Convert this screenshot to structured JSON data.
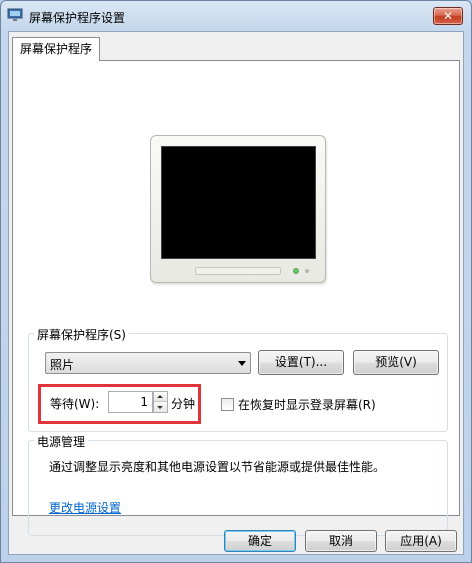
{
  "window": {
    "title": "屏幕保护程序设置"
  },
  "tab": {
    "label": "屏幕保护程序"
  },
  "screensaver": {
    "group_label": "屏幕保护程序(S)",
    "selected": "照片",
    "settings_label": "设置(T)...",
    "preview_label": "预览(V)",
    "wait_label": "等待(W):",
    "wait_value": "1",
    "minutes_label": "分钟",
    "resume_checkbox_label": "在恢复时显示登录屏幕(R)",
    "resume_checked": false
  },
  "power": {
    "group_label": "电源管理",
    "description": "通过调整显示亮度和其他电源设置以节省能源或提供最佳性能。",
    "link": "更改电源设置"
  },
  "buttons": {
    "ok": "确定",
    "cancel": "取消",
    "apply": "应用(A)"
  },
  "icons": {
    "window_icon": "monitor-settings-icon",
    "close": "close-icon",
    "dropdown": "chevron-down-icon",
    "spin_up": "arrow-up-icon",
    "spin_down": "arrow-down-icon"
  },
  "colors": {
    "highlight": "#e0333a",
    "link": "#0066cc"
  }
}
